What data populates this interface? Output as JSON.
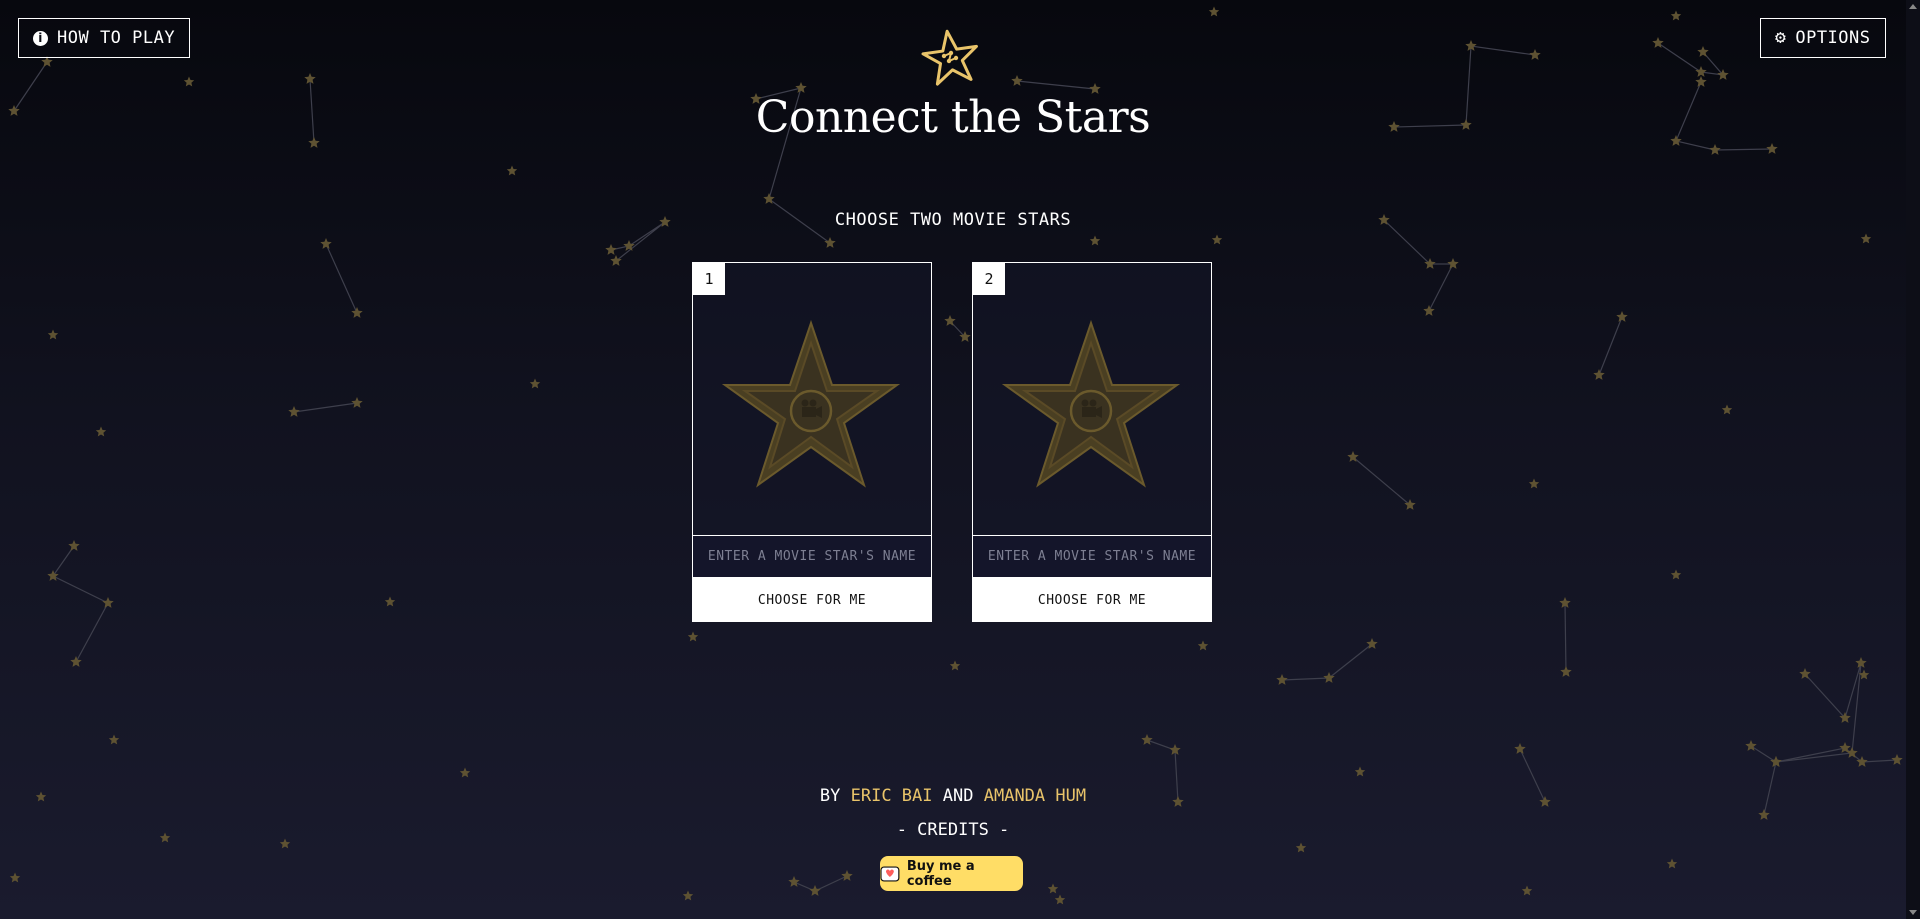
{
  "header": {
    "how_to_play": "HOW TO PLAY",
    "options": "OPTIONS",
    "title": "Connect the Stars",
    "subtitle": "CHOOSE TWO MOVIE STARS"
  },
  "cards": [
    {
      "number": "1",
      "placeholder": "ENTER A MOVIE STAR'S NAME",
      "value": "",
      "choose_label": "CHOOSE FOR ME"
    },
    {
      "number": "2",
      "placeholder": "ENTER A MOVIE STAR'S NAME",
      "value": "",
      "choose_label": "CHOOSE FOR ME"
    }
  ],
  "footer": {
    "by": "BY",
    "author1": "ERIC BAI",
    "and": "AND",
    "author2": "AMANDA HUM",
    "credits": "- CREDITS -",
    "coffee": "Buy me a coffee"
  },
  "icons": {
    "how_to_play": "info-icon",
    "options": "gear-icon",
    "logo": "star-logo-icon",
    "card_star": "hollywood-star-icon",
    "coffee": "coffee-cup-icon"
  },
  "colors": {
    "accent_gold": "#e9c46a",
    "background_top": "#07080e",
    "background_bottom": "#1a1b2e",
    "coffee_button": "#ffdd66"
  }
}
